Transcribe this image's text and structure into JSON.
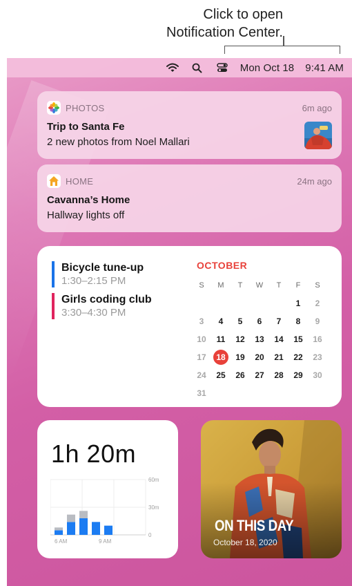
{
  "callout": {
    "line1": "Click to open",
    "line2": "Notification Center."
  },
  "menubar": {
    "icons": [
      "wifi-icon",
      "search-icon",
      "control-center-icon"
    ],
    "date": "Mon Oct 18",
    "time": "9:41 AM"
  },
  "notifications": [
    {
      "app": "PHOTOS",
      "time": "6m ago",
      "title": "Trip to Santa Fe",
      "body": "2 new photos from Noel Mallari",
      "icon": "photos-icon"
    },
    {
      "app": "HOME",
      "time": "24m ago",
      "title": "Cavanna’s Home",
      "body": "Hallway lights off",
      "icon": "home-icon"
    }
  ],
  "calendar": {
    "events": [
      {
        "title": "Bicycle tune-up",
        "time": "1:30–2:15 PM",
        "color": "#1a73e8"
      },
      {
        "title": "Girls coding club",
        "time": "3:30–4:30 PM",
        "color": "#e0245e"
      }
    ],
    "month": "OCTOBER",
    "weekdays": [
      "S",
      "M",
      "T",
      "W",
      "T",
      "F",
      "S"
    ],
    "weeks": [
      [
        "",
        "",
        "",
        "",
        "",
        "1",
        "2"
      ],
      [
        "3",
        "4",
        "5",
        "6",
        "7",
        "8",
        "9"
      ],
      [
        "10",
        "11",
        "12",
        "13",
        "14",
        "15",
        "16"
      ],
      [
        "17",
        "18",
        "19",
        "20",
        "21",
        "22",
        "23"
      ],
      [
        "24",
        "25",
        "26",
        "27",
        "28",
        "29",
        "30"
      ],
      [
        "31",
        "",
        "",
        "",
        "",
        "",
        ""
      ]
    ],
    "today": "18"
  },
  "screen_time": {
    "total": "1h 20m",
    "y_labels": [
      "60m",
      "30m",
      "0"
    ],
    "x_labels": [
      "6 AM",
      "9 AM"
    ],
    "bars_minutes": [
      {
        "blue": 5,
        "gray": 3
      },
      {
        "blue": 14,
        "gray": 8
      },
      {
        "blue": 18,
        "gray": 8
      },
      {
        "blue": 14,
        "gray": 0
      },
      {
        "blue": 10,
        "gray": 0
      }
    ],
    "colors": {
      "blue": "#1c7cf2",
      "gray": "#b9bcc2"
    }
  },
  "photo_memory": {
    "title": "ON THIS DAY",
    "date": "October 18, 2020"
  }
}
